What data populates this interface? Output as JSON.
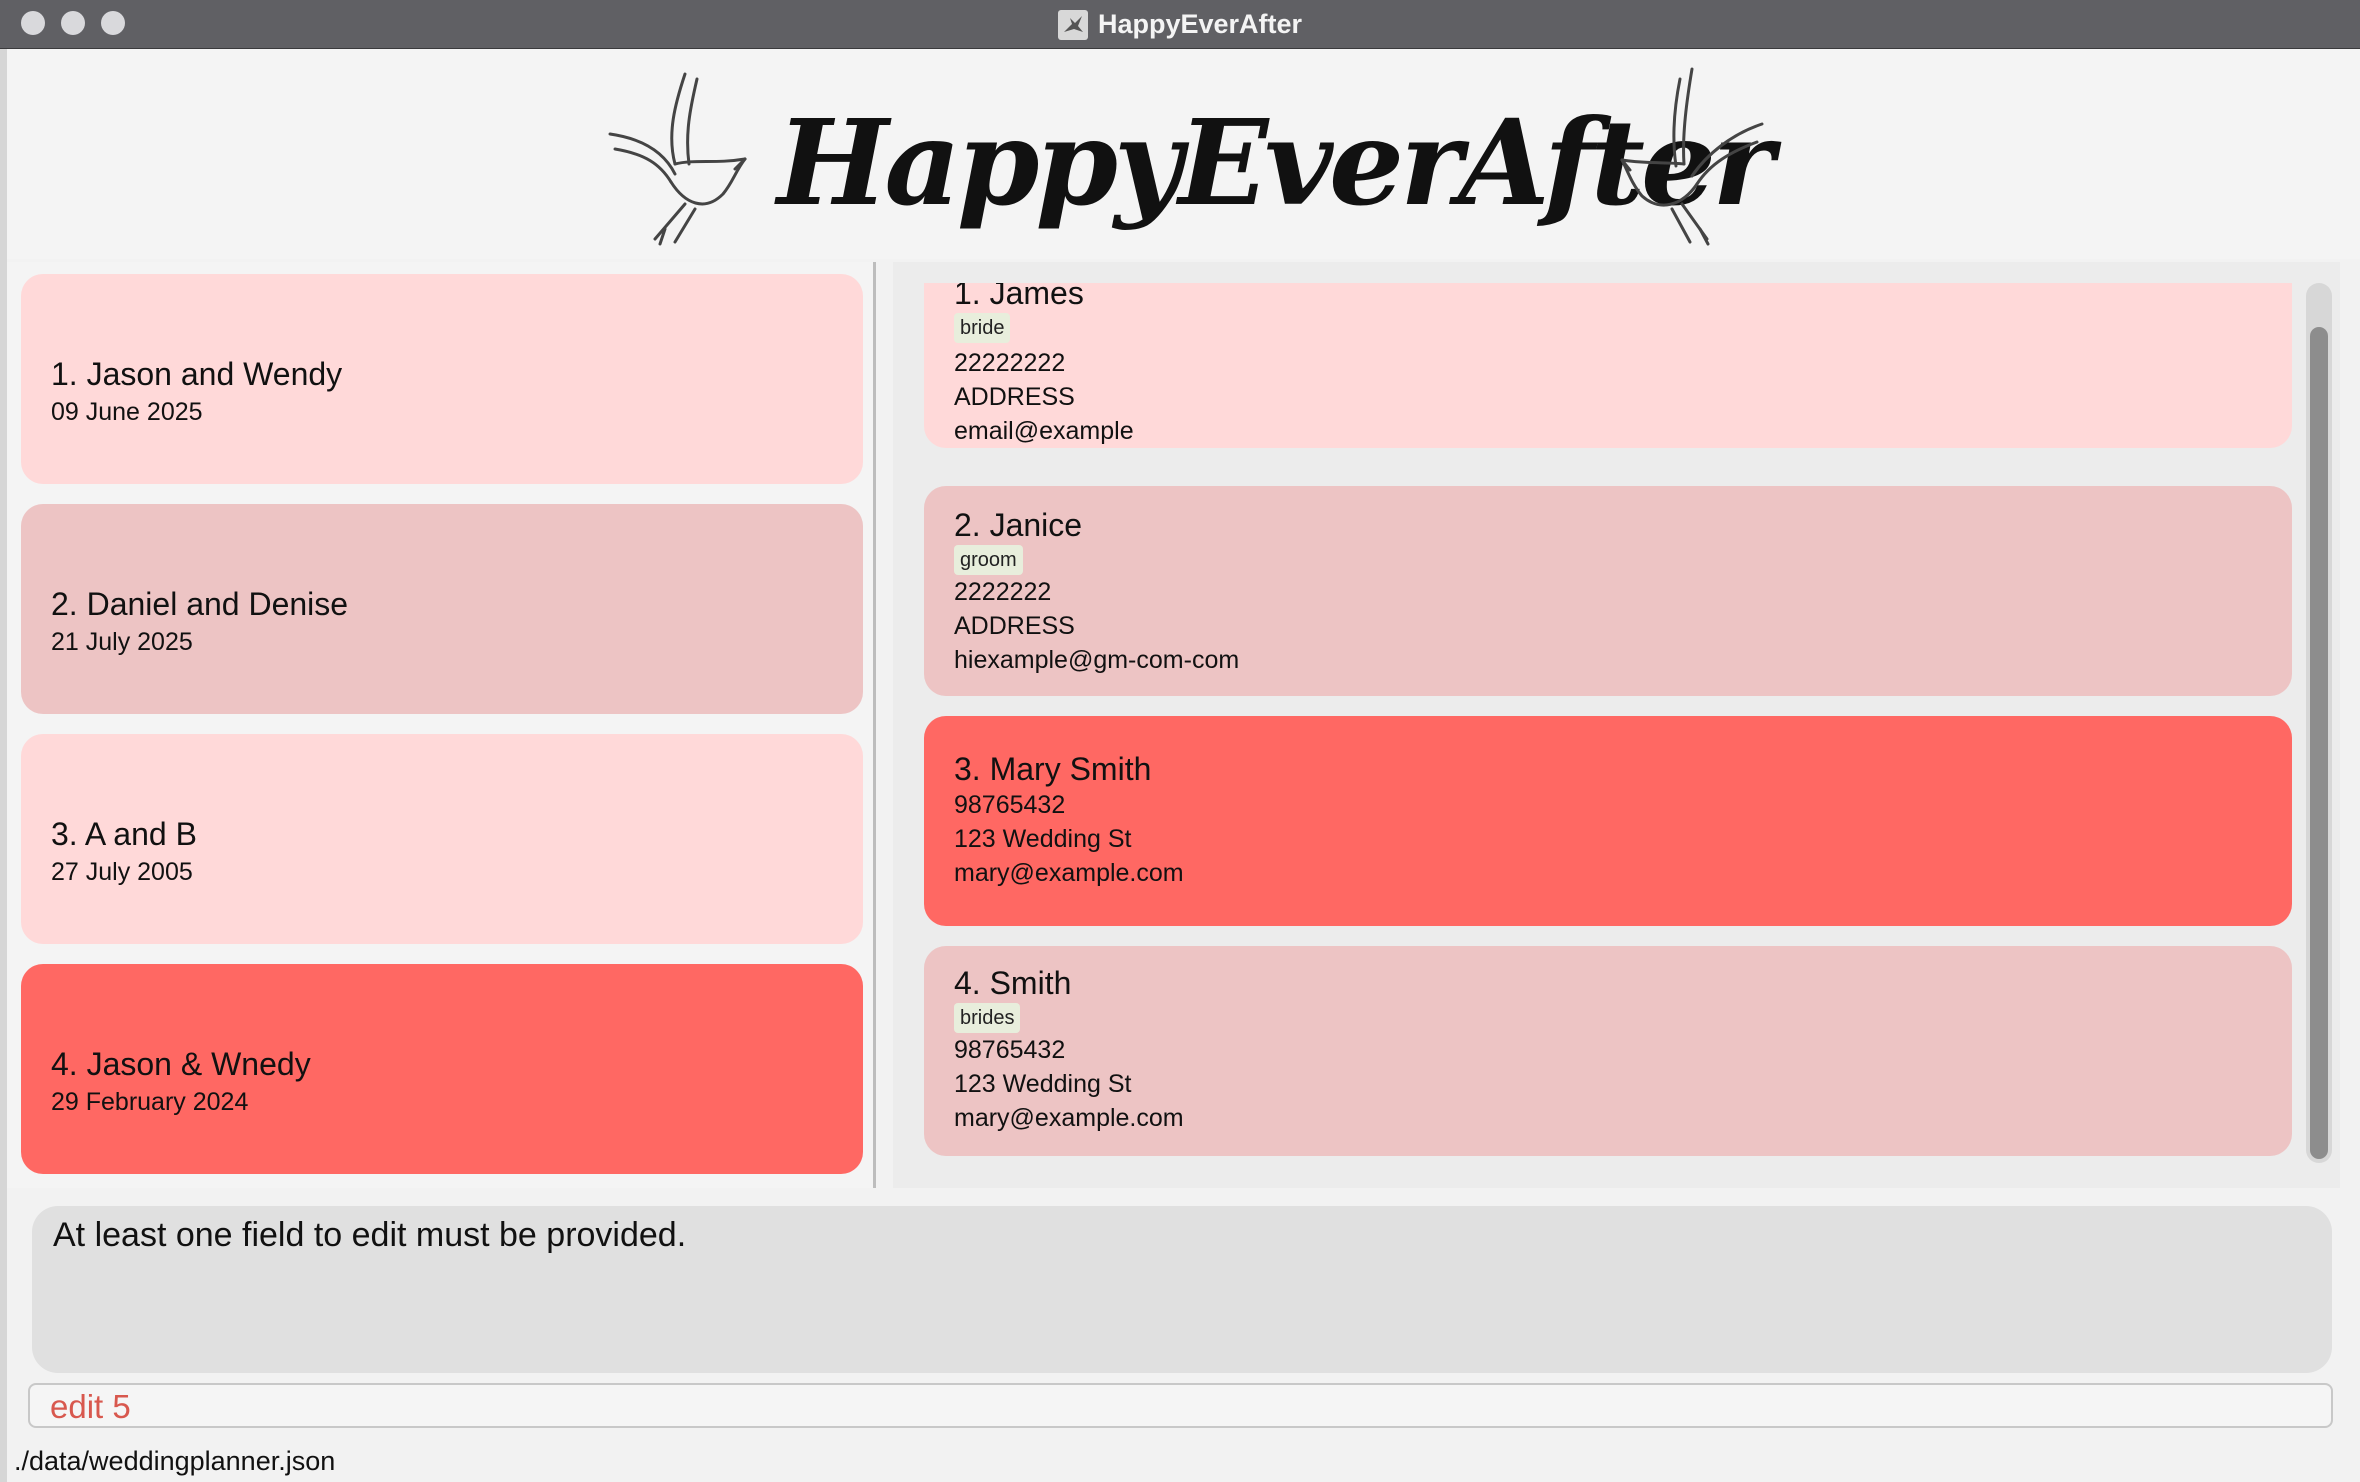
{
  "window": {
    "title": "HappyEverAfter"
  },
  "header": {
    "logo_text": "HappyEverAfter"
  },
  "weddings": [
    {
      "label": "1. Jason and Wendy",
      "date": "09 June 2025"
    },
    {
      "label": "2. Daniel and Denise",
      "date": "21 July 2025"
    },
    {
      "label": "3. A and B",
      "date": "27 July 2005"
    },
    {
      "label": "4. Jason & Wnedy",
      "date": "29 February 2024"
    }
  ],
  "persons": [
    {
      "label": "1. James",
      "tag": "bride",
      "phone": "22222222",
      "address": "ADDRESS",
      "email": "email@example"
    },
    {
      "label": "2. Janice",
      "tag": "groom",
      "phone": "2222222",
      "address": "ADDRESS",
      "email": "hiexample@gm-com-com"
    },
    {
      "label": "3. Mary Smith",
      "phone": "98765432",
      "address": "123 Wedding St",
      "email": "mary@example.com"
    },
    {
      "label": "4. Smith",
      "tag": "brides",
      "phone": "98765432",
      "address": "123 Wedding St",
      "email": "mary@example.com"
    }
  ],
  "result": {
    "message": "At least one field to edit must be provided."
  },
  "command": {
    "value": "edit 5"
  },
  "status": {
    "path": "./data/weddingplanner.json"
  },
  "colors": {
    "card_light": "#ffd9d9",
    "card_rose": "#edc4c4",
    "card_selected": "#ff6863",
    "command_error_text": "#d8584e"
  }
}
